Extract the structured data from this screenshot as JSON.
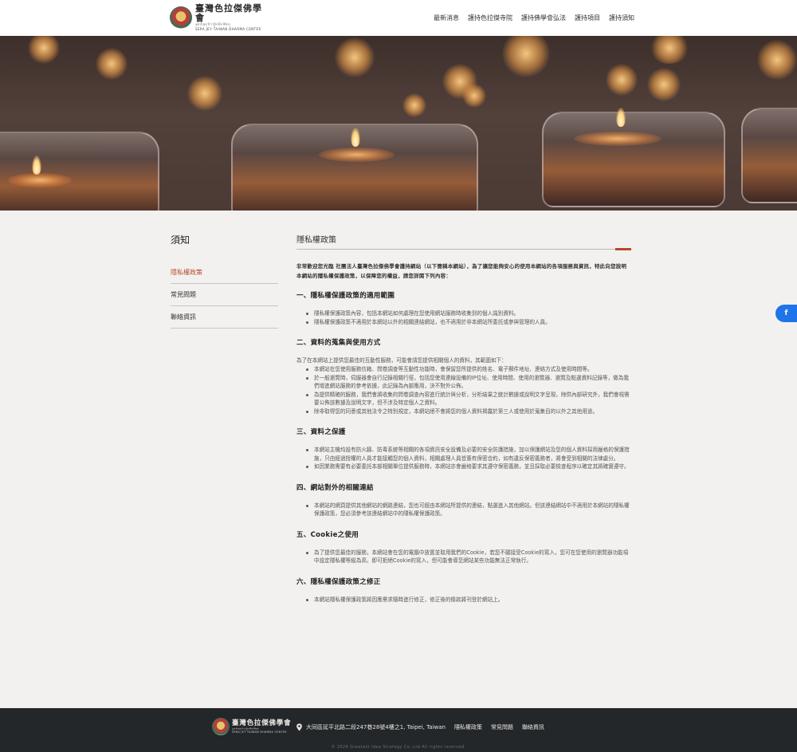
{
  "header": {
    "logo": {
      "name_cn": "臺灣色拉傑佛學會",
      "tibetan": "ཡུལ་ཐེ་ཝན་སེ་ར་བྱེས་ཆོས་ཚོགས།",
      "name_en": "SERA JEY TAIWAN DHARMA CENTER"
    },
    "nav": [
      "最新消息",
      "護持色拉傑寺院",
      "護持佛學會弘法",
      "護持項目",
      "護持須知"
    ]
  },
  "sidebar": {
    "title": "須知",
    "items": [
      {
        "label": "隱私權政策",
        "active": true
      },
      {
        "label": "常見問題",
        "active": false
      },
      {
        "label": "聯絡資訊",
        "active": false
      }
    ]
  },
  "main": {
    "title": "隱私權政策",
    "intro": "非常歡迎您光臨 社團法人臺灣色拉傑佛學會護持網站（以下簡稱本網站），為了讓您能夠安心的使用本網站的各項服務與資訊，特此向您說明本網站的隱私權保護政策，以保障您的權益，請您詳閱下列內容：",
    "sections": [
      {
        "heading": "一、隱私權保護政策的適用範圍",
        "lead": "",
        "items": [
          "隱私權保護政策內容，包括本網站如何處理在您使用網站服務時收集到的個人識別資料。",
          "隱私權保護政策不適用於本網站以外的相關連結網站，也不適用於非本網站所委託或參與管理的人員。"
        ]
      },
      {
        "heading": "二、資料的蒐集與使用方式",
        "lead": "為了在本網站上提供您最佳的互動性服務，可能會請您提供相關個人的資料，其範圍如下：",
        "items": [
          "本網站在您使用服務信箱、問卷調查等互動性功能時，會保留您所提供的姓名、電子郵件地址、連絡方式及使用時間等。",
          "於一般瀏覽時，伺服器會自行記錄相關行徑，包括您使用連線設備的IP位址、使用時間、使用的瀏覽器、瀏覽及點選資料記錄等，做為我們增進網站服務的參考依據，此記錄為內部應用，決不對外公佈。",
          "為提供精確的服務，我們會將收集的問卷調查內容進行統計與分析，分析結果之統計數據或說明文字呈現，除供內部研究外，我們會視需要公佈該數據及說明文字，但不涉及特定個人之資料。",
          "除非取得您的同意或其他法令之特別規定，本網站絕不會將您的個人資料揭露於第三人或使用於蒐集目的以外之其他用途。"
        ]
      },
      {
        "heading": "三、資料之保護",
        "lead": "",
        "items": [
          "本網站主機均設有防火牆、防毒系統等相關的各項資訊安全設備及必要的安全防護措施，加以保護網站及您的個人資料採用嚴格的保護措施，只由經過授權的人員才能接觸您的個人資料，相關處理人員皆簽有保密合約，如有違反保密義務者，將會受到相關的法律處分。",
          "如因業務需要有必要委託本部相關單位提供服務時，本網站亦會嚴格要求其遵守保密義務，並且採取必要檢查程序以確定其將確實遵守。"
        ]
      },
      {
        "heading": "四、網站對外的相關連結",
        "lead": "",
        "items": [
          "本網站的網頁提供其他網站的網路連結，您也可經由本網站所提供的連結，點選進入其他網站。但該連結網站中不適用於本網站的隱私權保護政策，您必須參考該連結網站中的隱私權保護政策。"
        ]
      },
      {
        "heading": "五、Cookie之使用",
        "lead": "",
        "items": [
          "為了提供您最佳的服務，本網站會在您的電腦中放置並取用我們的Cookie，若您不願接受Cookie的寫入，您可在您使用的瀏覽器功能項中設定隱私權等級為高，即可拒絕Cookie的寫入，但可能會導至網站某些功能無法正常執行。"
        ]
      },
      {
        "heading": "六、隱私權保護政策之修正",
        "lead": "",
        "items": [
          "本網站隱私權保護政策將因應需求隨時進行修正，修正後的條款將刊登於網站上。"
        ]
      }
    ]
  },
  "floating": {
    "facebook_label": "f"
  },
  "footer": {
    "logo": {
      "name_cn": "臺灣色拉傑佛學會",
      "tibetan": "ཡུལ་ཐེ་ཝན་སེ་ར་བྱེས་ཆོས་ཚོགས།",
      "name_en": "SERA JEY TAIWAN DHARMA CENTER"
    },
    "address": "大同區延平北路二段247巷28號4樓之1, Taipei, Taiwan",
    "links": [
      "隱私權政策",
      "常見問題",
      "聯絡資訊"
    ],
    "copyright": "© 2024 Greatest Idea Strategy Co.,Ltd All rights reserved."
  },
  "colors": {
    "accent": "#b44a2d",
    "footer_bg": "#23272a",
    "page_bg": "#f3f1ef",
    "facebook": "#1e74e8"
  },
  "icons": [
    "location-pin-icon",
    "facebook-icon"
  ]
}
